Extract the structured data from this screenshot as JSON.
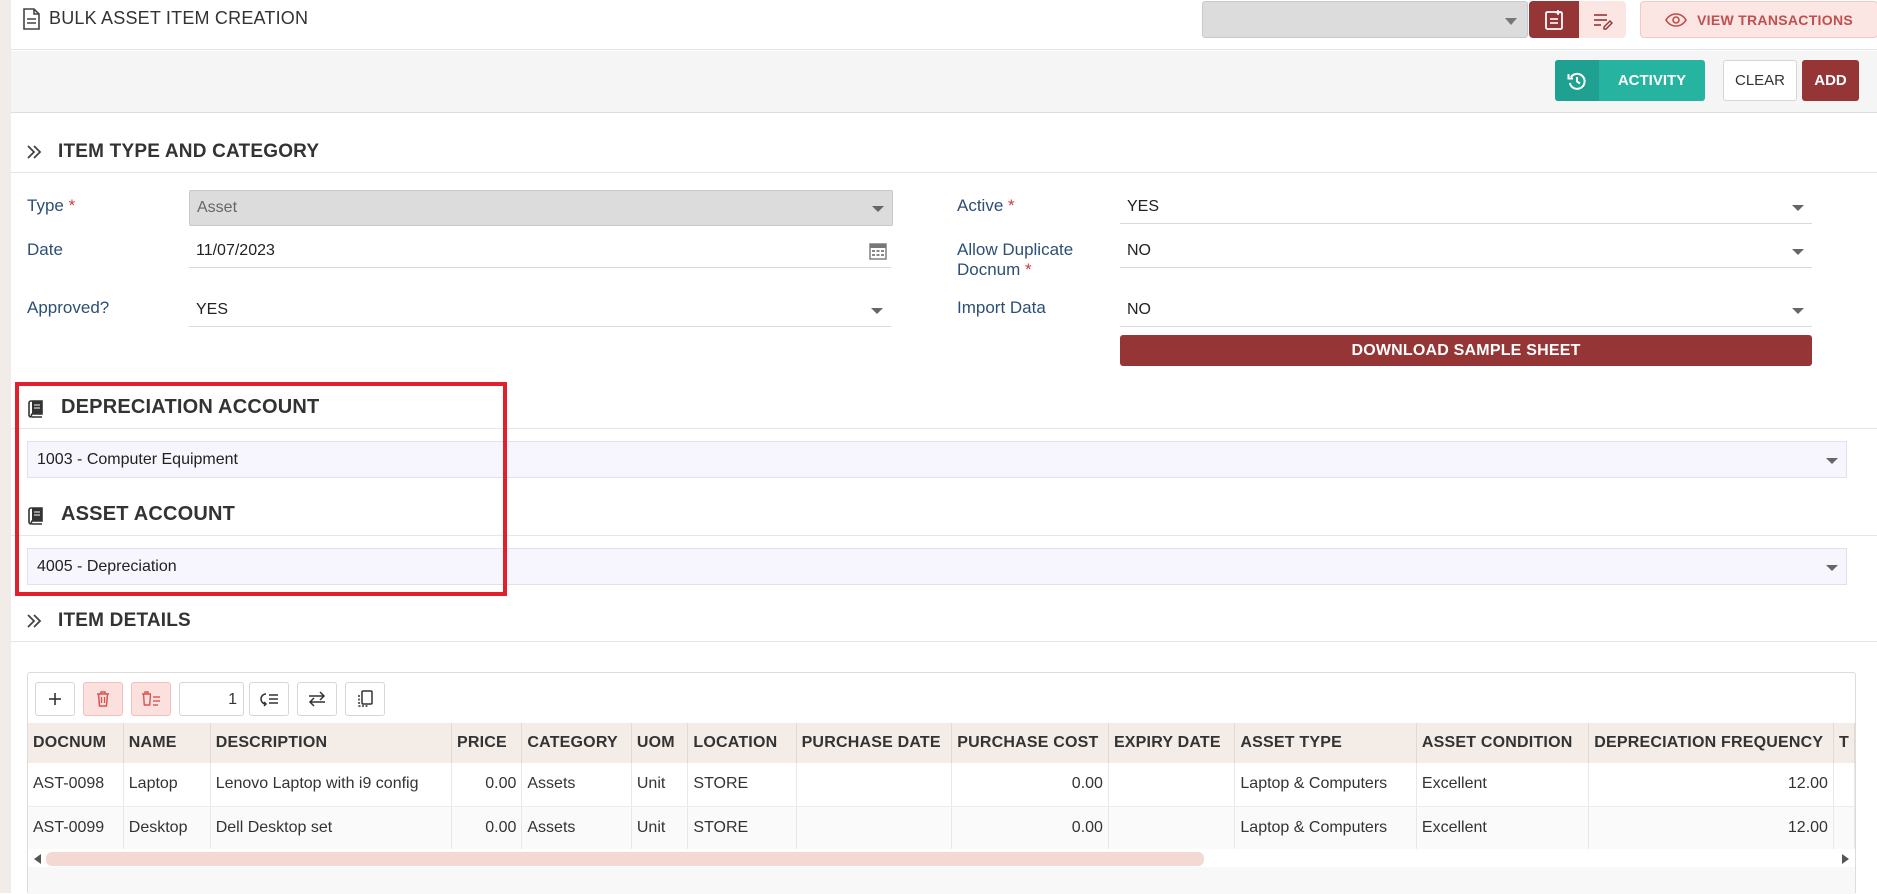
{
  "header": {
    "title": "BULK ASSET ITEM CREATION",
    "view_transactions_label": "VIEW TRANSACTIONS",
    "top_select_value": ""
  },
  "actions": {
    "activity_label": "ACTIVITY",
    "clear_label": "CLEAR",
    "add_label": "ADD"
  },
  "sections": {
    "item_type": "ITEM TYPE AND CATEGORY",
    "item_details": "ITEM DETAILS"
  },
  "form": {
    "type": {
      "label": "Type",
      "required": "*",
      "value": "Asset"
    },
    "date": {
      "label": "Date",
      "value": "11/07/2023"
    },
    "approved": {
      "label": "Approved?",
      "value": "YES"
    },
    "active": {
      "label": "Active",
      "required": "*",
      "value": "YES"
    },
    "allow_duplicate": {
      "label_line1": "Allow Duplicate",
      "label_line2": "Docnum",
      "required": "*",
      "value": "NO"
    },
    "import_data": {
      "label": "Import Data",
      "value": "NO"
    },
    "download_label": "DOWNLOAD SAMPLE SHEET"
  },
  "accounts": {
    "depreciation": {
      "title": "DEPRECIATION ACCOUNT",
      "value": "1003 - Computer Equipment"
    },
    "asset": {
      "title": "ASSET ACCOUNT",
      "value": "4005 - Depreciation"
    }
  },
  "grid": {
    "page_input": "1",
    "columns": [
      "DOCNUM",
      "NAME",
      "DESCRIPTION",
      "PRICE",
      "CATEGORY",
      "UOM",
      "LOCATION",
      "PURCHASE DATE",
      "PURCHASE COST",
      "EXPIRY DATE",
      "ASSET TYPE",
      "ASSET CONDITION",
      "DEPRECIATION FREQUENCY",
      "T"
    ],
    "rows": [
      [
        "AST-0098",
        "Laptop",
        "Lenovo Laptop with i9 config",
        "0.00",
        "Assets",
        "Unit",
        "STORE",
        "",
        "0.00",
        "",
        "Laptop & Computers",
        "Excellent",
        "12.00",
        ""
      ],
      [
        "AST-0099",
        "Desktop",
        "Dell Desktop set",
        "0.00",
        "Assets",
        "Unit",
        "STORE",
        "",
        "0.00",
        "",
        "Laptop & Computers",
        "Excellent",
        "12.00",
        ""
      ]
    ]
  },
  "colors": {
    "primary": "#963535",
    "teal": "#26b3a0",
    "label": "#2c4f74",
    "highlight": "#e0202a"
  }
}
